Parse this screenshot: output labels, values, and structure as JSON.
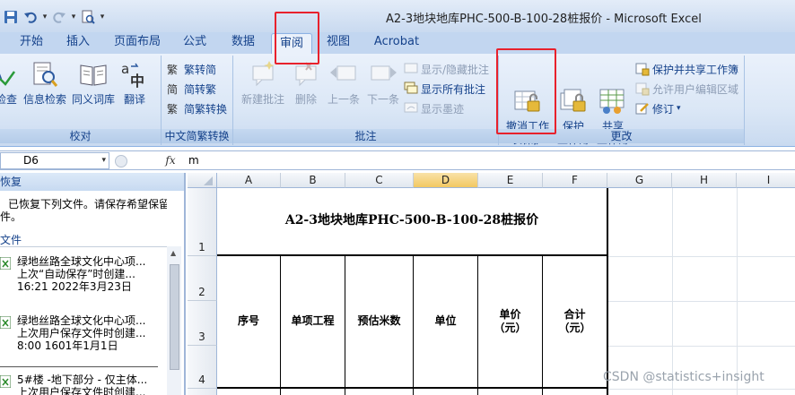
{
  "window": {
    "title": "A2-3地块地库PHC-500-B-100-28桩报价 - Microsoft Excel"
  },
  "quick_access": {
    "customize_label": "▾"
  },
  "tabs": [
    {
      "label": "开始",
      "active": false
    },
    {
      "label": "插入",
      "active": false
    },
    {
      "label": "页面布局",
      "active": false
    },
    {
      "label": "公式",
      "active": false
    },
    {
      "label": "数据",
      "active": false
    },
    {
      "label": "审阅",
      "active": true
    },
    {
      "label": "视图",
      "active": false
    },
    {
      "label": "Acrobat",
      "active": false
    }
  ],
  "ribbon": {
    "proofing": {
      "label": "校对",
      "buttons": [
        {
          "label": "检查",
          "icon": "spelling-icon"
        },
        {
          "label": "信息检索",
          "icon": "research-icon"
        },
        {
          "label": "同义词库",
          "icon": "thesaurus-icon"
        },
        {
          "label": "翻译",
          "icon": "translate-icon"
        }
      ]
    },
    "chinese_conversion": {
      "label": "中文简繁转换",
      "buttons": [
        {
          "label": "繁转简",
          "icon": "trad-to-simp-icon"
        },
        {
          "label": "简转繁",
          "icon": "simp-to-trad-icon"
        },
        {
          "label": "简繁转换",
          "icon": "convert-icon"
        }
      ]
    },
    "comments": {
      "label": "批注",
      "big_buttons": [
        {
          "label": "新建批注",
          "enabled": false
        },
        {
          "label": "删除",
          "enabled": false
        },
        {
          "label": "上一条",
          "enabled": false
        },
        {
          "label": "下一条",
          "enabled": false
        }
      ],
      "small_buttons": [
        {
          "label": "显示/隐藏批注",
          "enabled": false
        },
        {
          "label": "显示所有批注",
          "enabled": true
        },
        {
          "label": "显示墨迹",
          "enabled": false
        }
      ]
    },
    "changes": {
      "label": "更改",
      "unprotect_sheet": "撤消工作\n表保护",
      "protect_workbook": "保护\n工作簿",
      "share_workbook": "共享\n工作簿",
      "small_buttons": [
        {
          "label": "保护并共享工作簿",
          "enabled": true
        },
        {
          "label": "允许用户编辑区域",
          "enabled": false
        },
        {
          "label": "修订",
          "enabled": true,
          "dropdown": true
        }
      ]
    }
  },
  "formula_bar": {
    "name_box": "D6",
    "fx": "fx",
    "value": "m"
  },
  "recovery_pane": {
    "header": "恢复",
    "message_line1": "已恢复下列文件。请保存希望保留",
    "message_line2": "件。",
    "files_header": "文件",
    "files": [
      {
        "name": "绿地丝路全球文化中心项...",
        "detail": "上次“自动保存”时创建...",
        "time": "16:21 2022年3月23日"
      },
      {
        "name": "绿地丝路全球文化中心项...",
        "detail": "上次用户保存文件时创建...",
        "time": "8:00 1601年1月1日"
      },
      {
        "name": "5#楼 -地下部分 - 仅主体...",
        "detail": "上次用户保存文件时创建...",
        "time": ""
      }
    ]
  },
  "sheet": {
    "columns": [
      "A",
      "B",
      "C",
      "D",
      "E",
      "F",
      "G",
      "H",
      "I"
    ],
    "selected_column": "D",
    "rows": [
      "1",
      "2",
      "3",
      "4"
    ],
    "title": "A2-3地块地库PHC-500-B-100-28桩报价",
    "headers": [
      {
        "line1": "序号",
        "line2": ""
      },
      {
        "line1": "单项工程",
        "line2": ""
      },
      {
        "line1": "预估米数",
        "line2": ""
      },
      {
        "line1": "单位",
        "line2": ""
      },
      {
        "line1": "单价",
        "line2": "（元）"
      },
      {
        "line1": "合计",
        "line2": "（元）"
      }
    ]
  },
  "watermark": "CSDN @statistics+insight",
  "colors": {
    "highlight": "#e8212c",
    "ribbon_text": "#15428b",
    "selected_header": "#f2c862"
  }
}
